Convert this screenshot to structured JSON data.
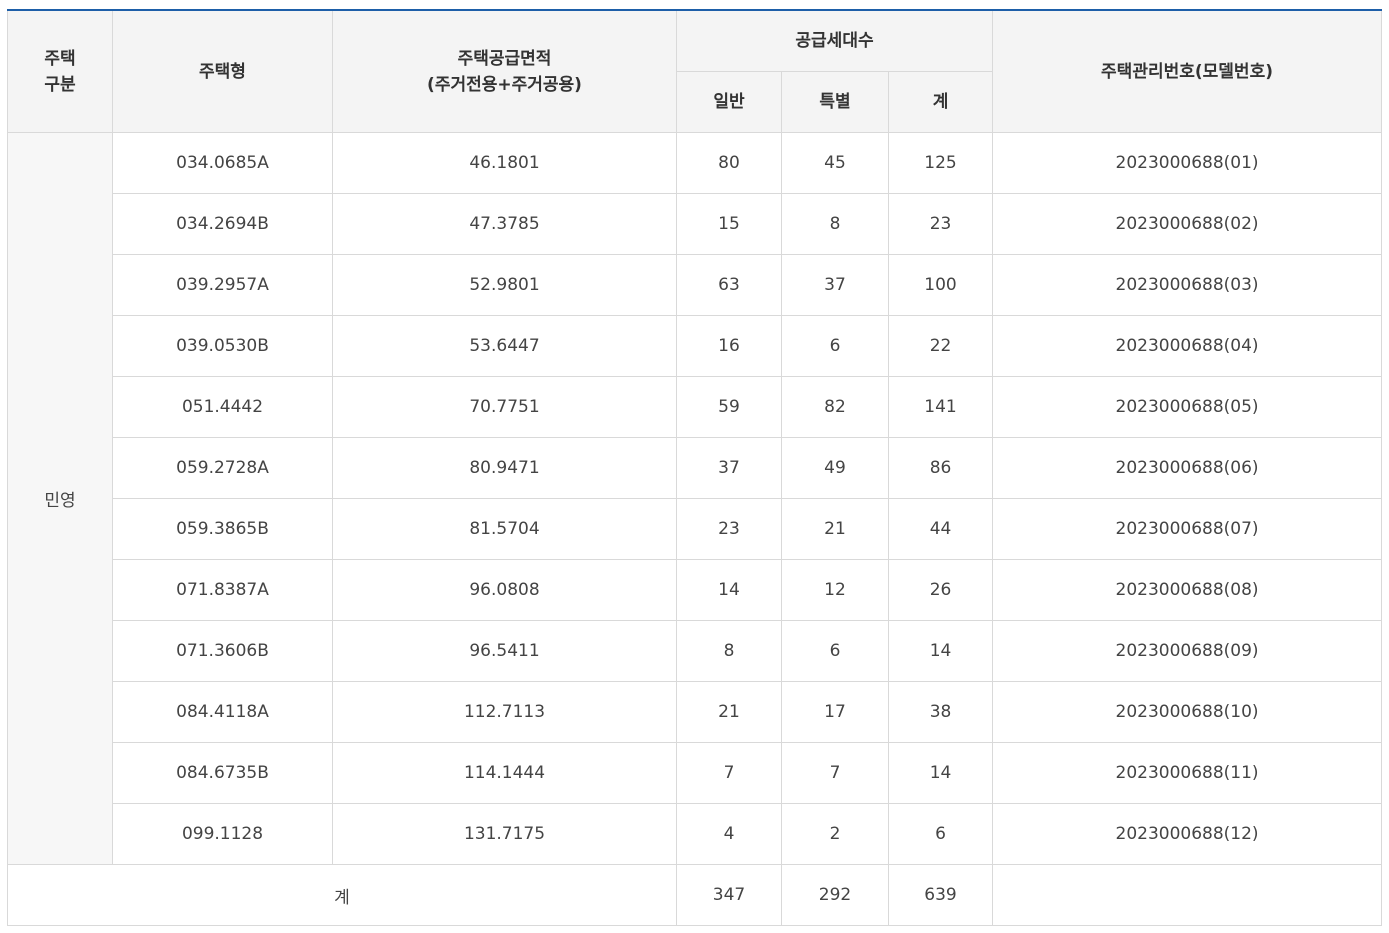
{
  "header": {
    "category": [
      "주택",
      "구분"
    ],
    "type": "주택형",
    "area": [
      "주택공급면적",
      "(주거전용+주거공용)"
    ],
    "supply_count": "공급세대수",
    "general": "일반",
    "special": "특별",
    "sum": "계",
    "management_no": "주택관리번호(모델번호)"
  },
  "category_value": "민영",
  "rows": [
    {
      "type": "034.0685A",
      "area": "46.1801",
      "general": "80",
      "special": "45",
      "sum": "125",
      "model": "2023000688(01)"
    },
    {
      "type": "034.2694B",
      "area": "47.3785",
      "general": "15",
      "special": "8",
      "sum": "23",
      "model": "2023000688(02)"
    },
    {
      "type": "039.2957A",
      "area": "52.9801",
      "general": "63",
      "special": "37",
      "sum": "100",
      "model": "2023000688(03)"
    },
    {
      "type": "039.0530B",
      "area": "53.6447",
      "general": "16",
      "special": "6",
      "sum": "22",
      "model": "2023000688(04)"
    },
    {
      "type": "051.4442",
      "area": "70.7751",
      "general": "59",
      "special": "82",
      "sum": "141",
      "model": "2023000688(05)"
    },
    {
      "type": "059.2728A",
      "area": "80.9471",
      "general": "37",
      "special": "49",
      "sum": "86",
      "model": "2023000688(06)"
    },
    {
      "type": "059.3865B",
      "area": "81.5704",
      "general": "23",
      "special": "21",
      "sum": "44",
      "model": "2023000688(07)"
    },
    {
      "type": "071.8387A",
      "area": "96.0808",
      "general": "14",
      "special": "12",
      "sum": "26",
      "model": "2023000688(08)"
    },
    {
      "type": "071.3606B",
      "area": "96.5411",
      "general": "8",
      "special": "6",
      "sum": "14",
      "model": "2023000688(09)"
    },
    {
      "type": "084.4118A",
      "area": "112.7113",
      "general": "21",
      "special": "17",
      "sum": "38",
      "model": "2023000688(10)"
    },
    {
      "type": "084.6735B",
      "area": "114.1444",
      "general": "7",
      "special": "7",
      "sum": "14",
      "model": "2023000688(11)"
    },
    {
      "type": "099.1128",
      "area": "131.7175",
      "general": "4",
      "special": "2",
      "sum": "6",
      "model": "2023000688(12)"
    }
  ],
  "total": {
    "label": "계",
    "general": "347",
    "special": "292",
    "sum": "639",
    "model": ""
  },
  "colors": {
    "top_border": "#1d5ea8",
    "header_bg": "#f4f4f4",
    "grid": "#d9d9d9"
  }
}
